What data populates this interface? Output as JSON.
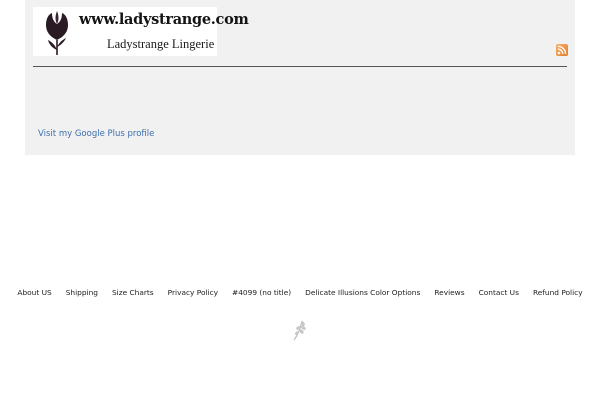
{
  "header": {
    "logo": {
      "url_text": "www.ladystrange.com",
      "name_text": "Ladystrange Lingerie",
      "icon": "tulip-icon"
    },
    "rss_icon": "rss-icon",
    "google_plus_link": "Visit my Google Plus profile"
  },
  "footer": {
    "links": [
      "About US",
      "Shipping",
      "Size Charts",
      "Privacy Policy",
      "#4099 (no title)",
      "Delicate Illusions Color Options",
      "Reviews",
      "Contact Us",
      "Refund Policy"
    ],
    "credit_icon": "leaf-icon"
  },
  "colors": {
    "header_bg": "#f1f1f1",
    "link_blue": "#3d6fae",
    "rss_orange": "#e57a24",
    "tulip": "#2a1a24"
  }
}
